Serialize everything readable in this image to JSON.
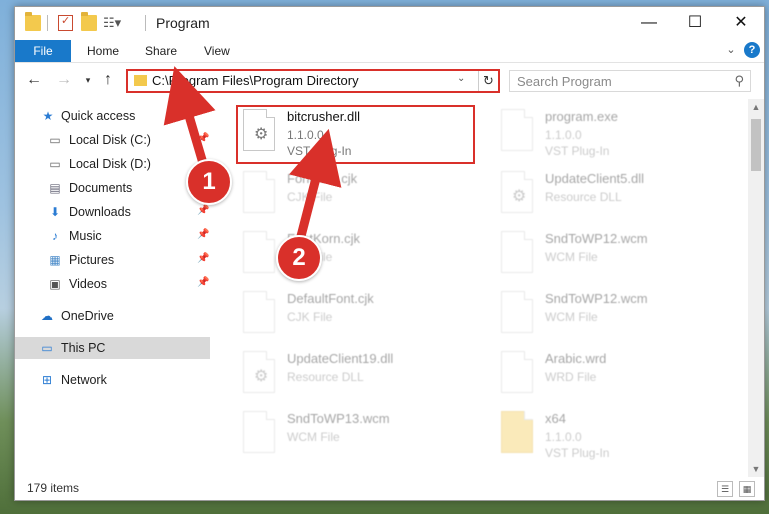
{
  "window": {
    "title": "Program",
    "controls": {
      "minimize": "—",
      "maximize": "☐",
      "close": "✕"
    }
  },
  "ribbon": {
    "tabs": [
      "File",
      "Home",
      "Share",
      "View"
    ]
  },
  "address": {
    "path": "C:\\Program Files\\Program Directory",
    "search_placeholder": "Search Program"
  },
  "sidebar": {
    "items": [
      {
        "label": "Quick access",
        "icon": "star-icon",
        "pinned": false
      },
      {
        "label": "Local Disk (C:)",
        "icon": "drive-icon",
        "pinned": true
      },
      {
        "label": "Local Disk (D:)",
        "icon": "drive-icon",
        "pinned": false
      },
      {
        "label": "Documents",
        "icon": "documents-icon",
        "pinned": false
      },
      {
        "label": "Downloads",
        "icon": "download-icon",
        "pinned": true
      },
      {
        "label": "Music",
        "icon": "music-icon",
        "pinned": true
      },
      {
        "label": "Pictures",
        "icon": "pictures-icon",
        "pinned": true
      },
      {
        "label": "Videos",
        "icon": "videos-icon",
        "pinned": true
      },
      {
        "label": "OneDrive",
        "icon": "cloud-icon",
        "pinned": false
      },
      {
        "label": "This PC",
        "icon": "computer-icon",
        "pinned": false
      },
      {
        "label": "Network",
        "icon": "network-icon",
        "pinned": false
      }
    ]
  },
  "files": [
    {
      "name": "bitcrusher.dll",
      "meta1": "1.1.0.0",
      "meta2": "VST Plug-In",
      "highlighted": true
    },
    {
      "name": "program.exe",
      "meta1": "1.1.0.0",
      "meta2": "VST Plug-In"
    },
    {
      "name": "Fontconf.cjk",
      "meta1": "CJK File",
      "meta2": ""
    },
    {
      "name": "UpdateClient5.dll",
      "meta1": "Resource DLL",
      "meta2": ""
    },
    {
      "name": "FontKorn.cjk",
      "meta1": "CJK File",
      "meta2": ""
    },
    {
      "name": "SndToWP12.wcm",
      "meta1": "WCM File",
      "meta2": ""
    },
    {
      "name": "DefaultFont.cjk",
      "meta1": "CJK File",
      "meta2": ""
    },
    {
      "name": "SndToWP12.wcm",
      "meta1": "WCM File",
      "meta2": ""
    },
    {
      "name": "UpdateClient19.dll",
      "meta1": "Resource DLL",
      "meta2": ""
    },
    {
      "name": "Arabic.wrd",
      "meta1": "WRD File",
      "meta2": ""
    },
    {
      "name": "SndToWP13.wcm",
      "meta1": "WCM File",
      "meta2": ""
    },
    {
      "name": "x64",
      "meta1": "1.1.0.0",
      "meta2": "VST Plug-In"
    }
  ],
  "status": {
    "items_count": "179 items"
  },
  "annotations": {
    "step1": "1",
    "step2": "2",
    "color": "#d9302a"
  }
}
